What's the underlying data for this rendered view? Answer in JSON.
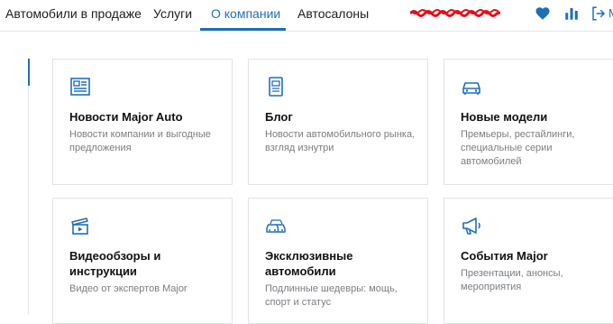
{
  "nav": {
    "items": [
      {
        "label": "Автомобили в продаже"
      },
      {
        "label": "Услуги"
      },
      {
        "label": "О компании"
      },
      {
        "label": "Автосалоны"
      }
    ],
    "active_index": 2,
    "icons": [
      "heart-icon",
      "bar-chart-icon",
      "login-icon"
    ],
    "login_fragment": "М"
  },
  "cards": [
    {
      "title": "Новости Major Auto",
      "description": "Новости компании и выгодные предложения",
      "icon": "newspaper-icon"
    },
    {
      "title": "Блог",
      "description": "Новости автомобильного рынка, взгляд изнутри",
      "icon": "blog-document-icon"
    },
    {
      "title": "Новые модели",
      "description": "Премьеры, рестайлинги, специальные серии автомобилей",
      "icon": "car-icon"
    },
    {
      "title": "Видеообзоры и инструкции",
      "description": "Видео от экспертов Major",
      "icon": "video-clapper-icon"
    },
    {
      "title": "Эксклюзивные автомобили",
      "description": "Подлинные шедевры: мощь, спорт и статус",
      "icon": "cars-icon"
    },
    {
      "title": "События Major",
      "description": "Презентации, анонсы, мероприятия",
      "icon": "megaphone-icon"
    }
  ],
  "colors": {
    "accent": "#1e6fb8",
    "text": "#111111",
    "muted": "#7a7d82",
    "border": "#e1e4e8",
    "redaction": "#e0101a"
  }
}
